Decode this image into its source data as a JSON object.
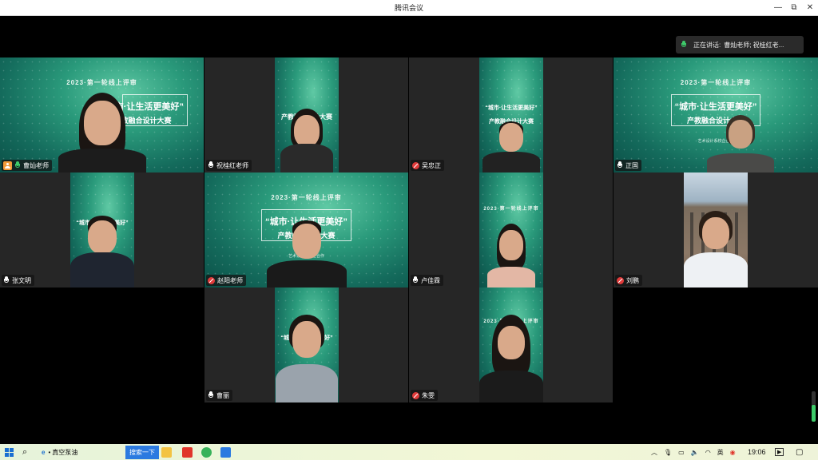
{
  "window": {
    "title": "腾讯会议",
    "controls": [
      "—",
      "⧉",
      "✕"
    ]
  },
  "speaking_indicator": {
    "label": "正在讲话:",
    "names": "曹灿老师; 祝桂红老..."
  },
  "poster": {
    "line1": "2023·第一轮线上评审",
    "line2": "“城市·让生活更美好”",
    "line3": "产教融合设计大赛",
    "line4": "艺术设计系校企合作"
  },
  "participants": [
    {
      "name": "曹灿老师",
      "mic": "speaking",
      "host": true
    },
    {
      "name": "祝桂红老师",
      "mic": "on"
    },
    {
      "name": "吴忠正",
      "mic": "muted"
    },
    {
      "name": "正国",
      "mic": "on"
    },
    {
      "name": "张文明",
      "mic": "on"
    },
    {
      "name": "赵阳老师",
      "mic": "muted"
    },
    {
      "name": "卢佳霖",
      "mic": "on"
    },
    {
      "name": "刘鹏",
      "mic": "muted"
    },
    {
      "name": "曹丽",
      "mic": "on"
    },
    {
      "name": "朱雯",
      "mic": "muted"
    }
  ],
  "volume_level": 0.55,
  "taskbar": {
    "search_text": "真空泵油",
    "search_button": "搜索一下",
    "time": "19:06",
    "tray_icons": [
      "chevron-up-icon",
      "mic-icon",
      "battery-icon",
      "speaker-icon",
      "wifi-icon",
      "input-icon",
      "antivirus-icon"
    ]
  }
}
